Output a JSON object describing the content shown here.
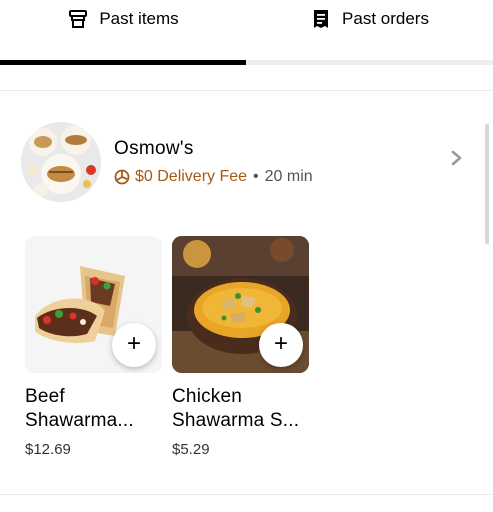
{
  "tabs": [
    {
      "label": "Past items",
      "icon": "dish-icon",
      "active": true
    },
    {
      "label": "Past orders",
      "icon": "receipt-icon",
      "active": false
    }
  ],
  "store": {
    "name": "Osmow's",
    "delivery_fee": "$0 Delivery Fee",
    "separator": "•",
    "eta": "20 min",
    "fee_color": "#a55a16"
  },
  "items": [
    {
      "name_line1": "Beef",
      "name_line2": "Shawarma...",
      "price": "$12.69",
      "add_label": "+"
    },
    {
      "name_line1": "Chicken",
      "name_line2": "Shawarma S...",
      "price": "$5.29",
      "add_label": "+"
    }
  ],
  "colors": {
    "active_tab": "#000000",
    "inactive_tab": "#eeeeee",
    "divider": "#ececec"
  }
}
